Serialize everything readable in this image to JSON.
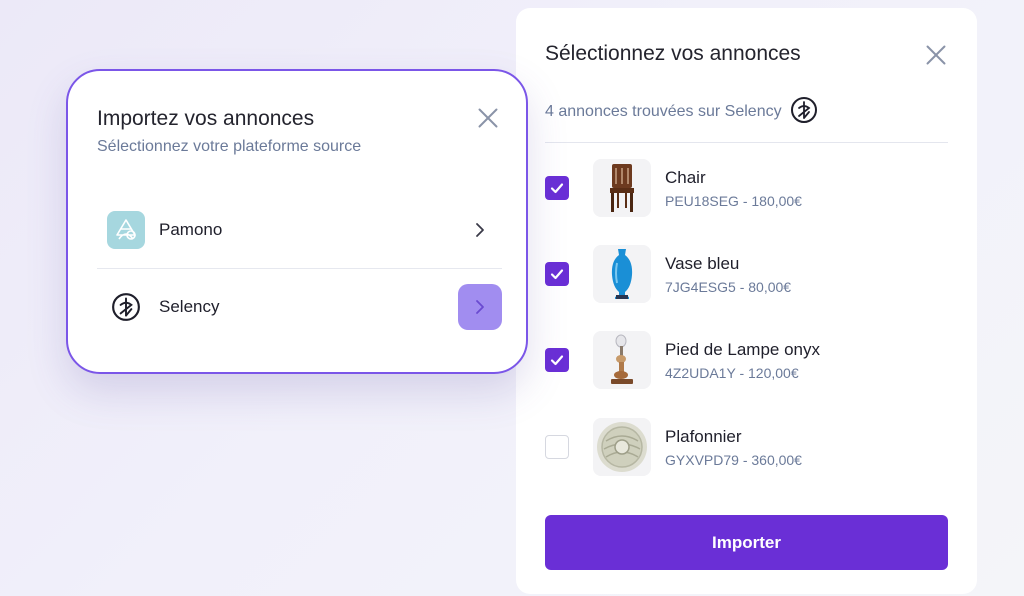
{
  "import_modal": {
    "title": "Importez vos annonces",
    "subtitle": "Sélectionnez votre plateforme source",
    "platforms": [
      {
        "label": "Pamono",
        "icon": "pamono-logo-icon",
        "active": false
      },
      {
        "label": "Selency",
        "icon": "selency-logo-icon",
        "active": true
      }
    ]
  },
  "select_panel": {
    "title": "Sélectionnez vos annonces",
    "found_text": "4 annonces trouvées sur Selency",
    "items": [
      {
        "name": "Chair",
        "meta": "PEU18SEG - 180,00€",
        "checked": true,
        "icon": "chair-thumbnail"
      },
      {
        "name": "Vase bleu",
        "meta": "7JG4ESG5 - 80,00€",
        "checked": true,
        "icon": "vase-thumbnail"
      },
      {
        "name": "Pied de Lampe onyx",
        "meta": "4Z2UDA1Y - 120,00€",
        "checked": true,
        "icon": "lamp-thumbnail"
      },
      {
        "name": "Plafonnier",
        "meta": "GYXVPD79 - 360,00€",
        "checked": false,
        "icon": "ceiling-light-thumbnail"
      }
    ],
    "import_label": "Importer"
  },
  "colors": {
    "accent": "#6a2fd6",
    "modal_border": "#7b56e8",
    "active_chevron_bg": "#a18df0",
    "muted_text": "#6b7a99"
  }
}
